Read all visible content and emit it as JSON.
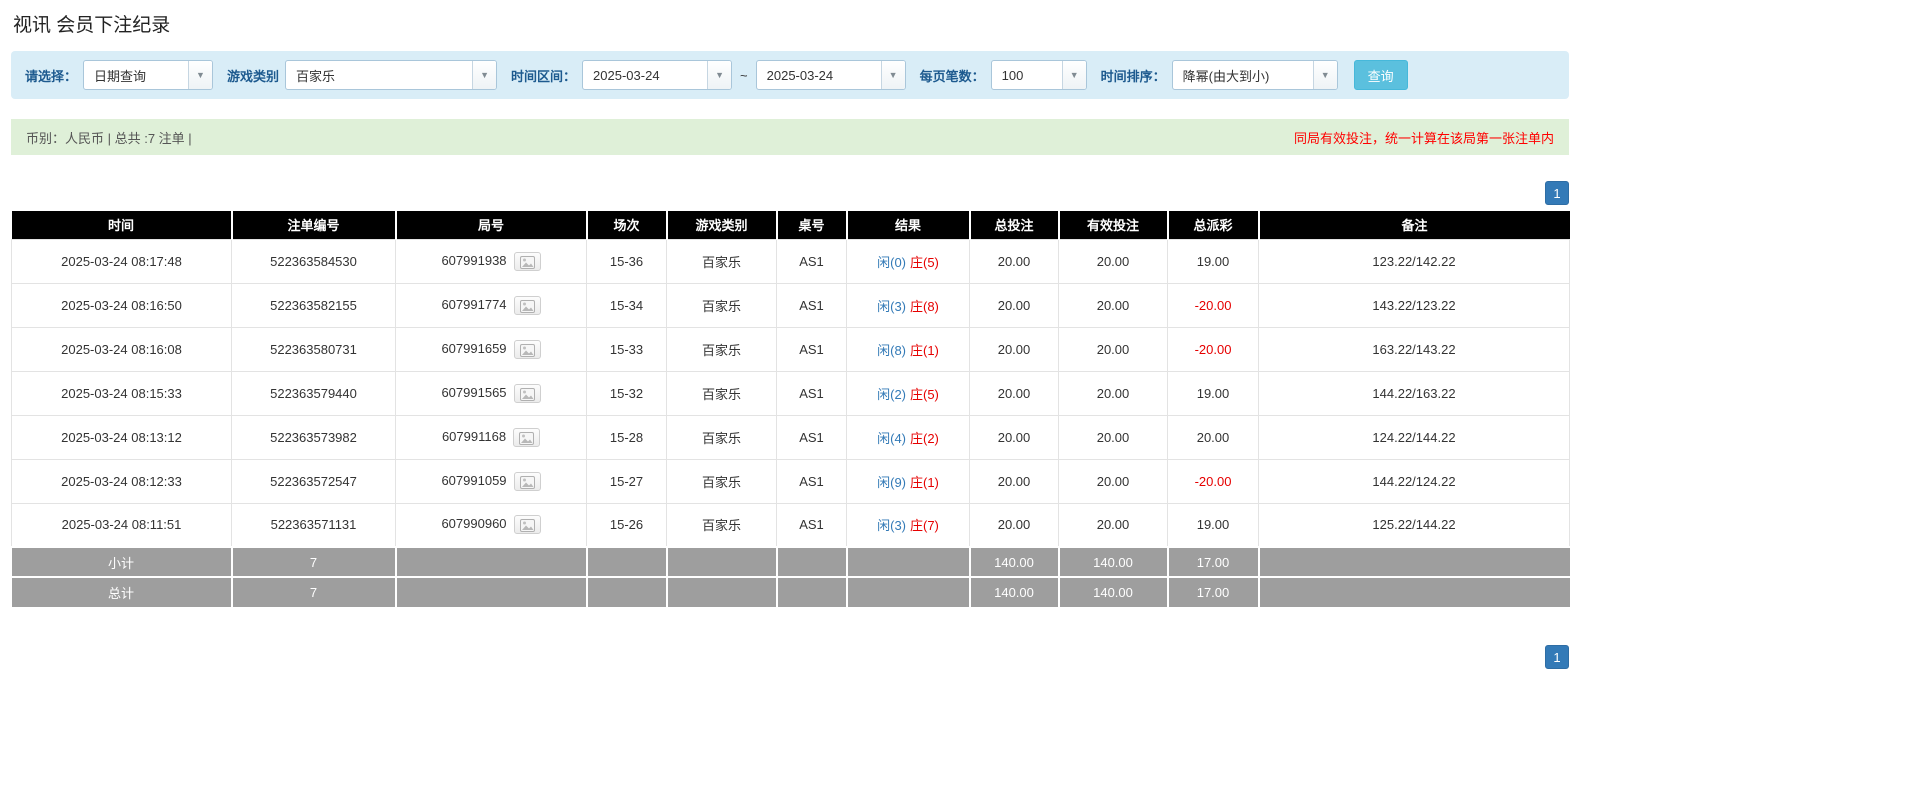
{
  "page": {
    "title": "视讯 会员下注纪录"
  },
  "filters": {
    "select_label": "请选择：",
    "select_value": "日期查询",
    "game_label": "游戏类别",
    "game_value": "百家乐",
    "range_label": "时间区间：",
    "date_from": "2025-03-24",
    "range_separator": "~",
    "date_to": "2025-03-24",
    "page_size_label": "每页笔数：",
    "page_size_value": "100",
    "sort_label": "时间排序：",
    "sort_value": "降幂(由大到小)",
    "search_label": "查询"
  },
  "summary": {
    "currency_info": "币别：人民币 | 总共 :7 注单 |",
    "notice": "同局有效投注，统一计算在该局第一张注单内"
  },
  "pagination": {
    "current_page": "1"
  },
  "table": {
    "headers": [
      "时间",
      "注单编号",
      "局号",
      "场次",
      "游戏类别",
      "桌号",
      "结果",
      "总投注",
      "有效投注",
      "总派彩",
      "备注"
    ],
    "rows": [
      {
        "time": "2025-03-24 08:17:48",
        "bet_id": "522363584530",
        "round": "607991938",
        "session": "15-36",
        "game": "百家乐",
        "table_no": "AS1",
        "result_player": "闲(0)",
        "result_banker": "庄(5)",
        "total_bet": "20.00",
        "valid_bet": "20.00",
        "payout": "19.00",
        "remark": "123.22/142.22"
      },
      {
        "time": "2025-03-24 08:16:50",
        "bet_id": "522363582155",
        "round": "607991774",
        "session": "15-34",
        "game": "百家乐",
        "table_no": "AS1",
        "result_player": "闲(3)",
        "result_banker": "庄(8)",
        "total_bet": "20.00",
        "valid_bet": "20.00",
        "payout": "-20.00",
        "remark": "143.22/123.22"
      },
      {
        "time": "2025-03-24 08:16:08",
        "bet_id": "522363580731",
        "round": "607991659",
        "session": "15-33",
        "game": "百家乐",
        "table_no": "AS1",
        "result_player": "闲(8)",
        "result_banker": "庄(1)",
        "total_bet": "20.00",
        "valid_bet": "20.00",
        "payout": "-20.00",
        "remark": "163.22/143.22"
      },
      {
        "time": "2025-03-24 08:15:33",
        "bet_id": "522363579440",
        "round": "607991565",
        "session": "15-32",
        "game": "百家乐",
        "table_no": "AS1",
        "result_player": "闲(2)",
        "result_banker": "庄(5)",
        "total_bet": "20.00",
        "valid_bet": "20.00",
        "payout": "19.00",
        "remark": "144.22/163.22"
      },
      {
        "time": "2025-03-24 08:13:12",
        "bet_id": "522363573982",
        "round": "607991168",
        "session": "15-28",
        "game": "百家乐",
        "table_no": "AS1",
        "result_player": "闲(4)",
        "result_banker": "庄(2)",
        "total_bet": "20.00",
        "valid_bet": "20.00",
        "payout": "20.00",
        "remark": "124.22/144.22"
      },
      {
        "time": "2025-03-24 08:12:33",
        "bet_id": "522363572547",
        "round": "607991059",
        "session": "15-27",
        "game": "百家乐",
        "table_no": "AS1",
        "result_player": "闲(9)",
        "result_banker": "庄(1)",
        "total_bet": "20.00",
        "valid_bet": "20.00",
        "payout": "-20.00",
        "remark": "144.22/124.22"
      },
      {
        "time": "2025-03-24 08:11:51",
        "bet_id": "522363571131",
        "round": "607990960",
        "session": "15-26",
        "game": "百家乐",
        "table_no": "AS1",
        "result_player": "闲(3)",
        "result_banker": "庄(7)",
        "total_bet": "20.00",
        "valid_bet": "20.00",
        "payout": "19.00",
        "remark": "125.22/144.22"
      }
    ],
    "subtotal": {
      "label": "小计",
      "count": "7",
      "total_bet": "140.00",
      "valid_bet": "140.00",
      "payout": "17.00"
    },
    "grand_total": {
      "label": "总计",
      "count": "7",
      "total_bet": "140.00",
      "valid_bet": "140.00",
      "payout": "17.00"
    }
  },
  "colors": {
    "accent_blue": "#337ab7",
    "negative_red": "#e60000",
    "notice_red": "#ff0000",
    "filter_bar_bg": "#d9edf7",
    "summary_bar_bg": "#dff0d8",
    "table_header_bg": "#000000",
    "table_footer_bg": "#9e9e9e",
    "search_button_bg": "#5bc0de"
  }
}
